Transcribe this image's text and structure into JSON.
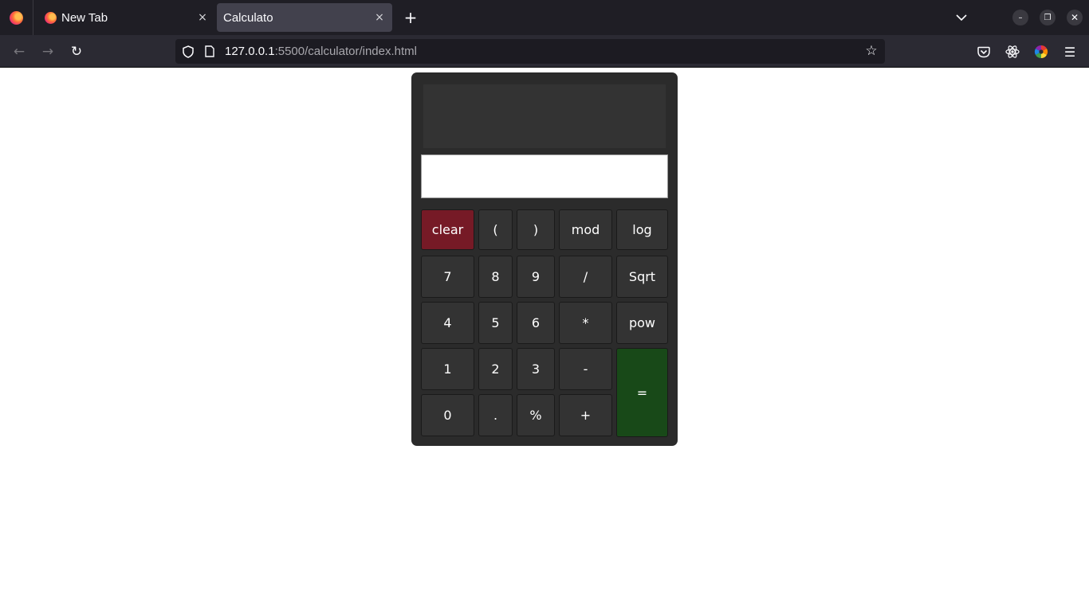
{
  "browser": {
    "tabs": [
      {
        "title": "New Tab",
        "active": false
      },
      {
        "title": "Calculato",
        "active": true
      }
    ],
    "url": {
      "host": "127.0.0.1",
      "rest": ":5500/calculator/index.html"
    },
    "icons": {
      "firefox_menu": "firefox-icon",
      "close": "×",
      "new_tab": "+",
      "tab_list": "chevron-down-icon",
      "back": "←",
      "forward": "→",
      "reload": "↻",
      "star": "☆",
      "menu": "☰",
      "minimize": "–",
      "maximize": "❐",
      "close_window": "✕"
    }
  },
  "calculator": {
    "display": "",
    "input_value": "",
    "keys": {
      "clear": "clear",
      "lparen": "(",
      "rparen": ")",
      "mod": "mod",
      "log": "log",
      "k7": "7",
      "k8": "8",
      "k9": "9",
      "divide": "/",
      "sqrt": "Sqrt",
      "k4": "4",
      "k5": "5",
      "k6": "6",
      "multiply": "*",
      "pow": "pow",
      "k1": "1",
      "k2": "2",
      "k3": "3",
      "minus": "-",
      "equals": "=",
      "k0": "0",
      "dot": ".",
      "percent": "%",
      "plus": "+"
    },
    "colors": {
      "body": "#2b2b2b",
      "key": "#333333",
      "clear": "#761a26",
      "equals": "#184918"
    }
  }
}
